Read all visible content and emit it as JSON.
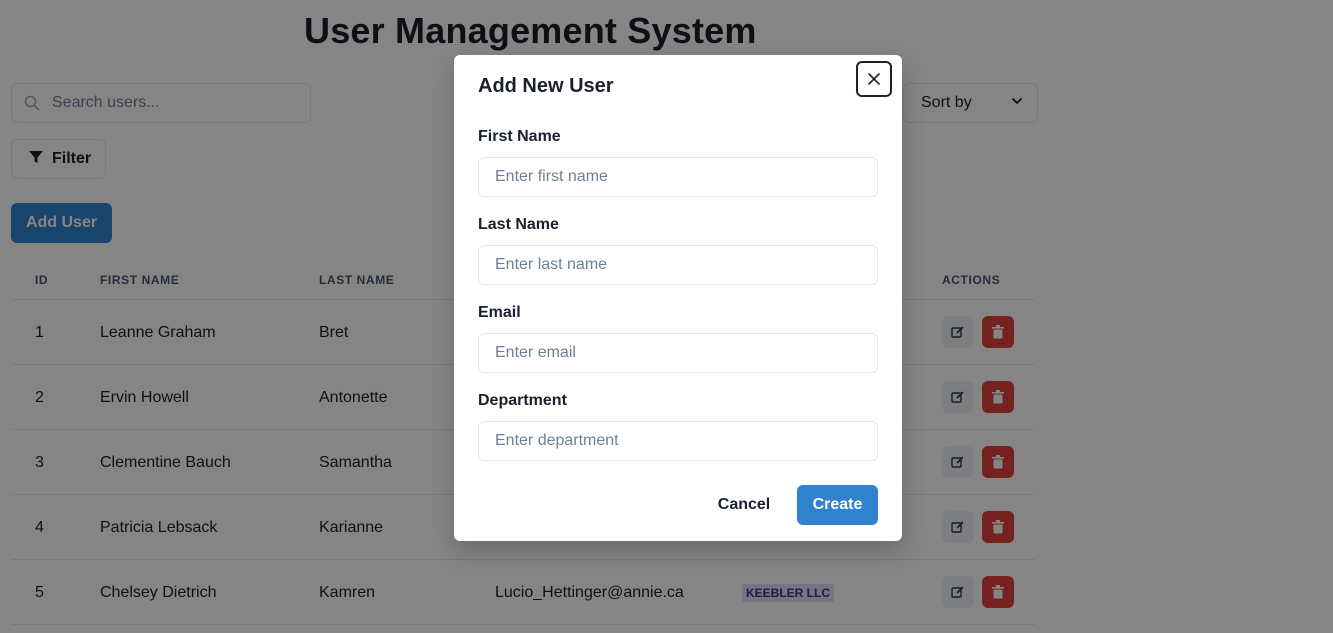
{
  "header": {
    "title": "User Management System"
  },
  "search": {
    "placeholder": "Search users..."
  },
  "sort": {
    "label": "Sort by"
  },
  "filter": {
    "label": "Filter"
  },
  "toolbar": {
    "add_user_label": "Add User"
  },
  "table": {
    "columns": [
      "ID",
      "FIRST NAME",
      "LAST NAME",
      "ACTIONS"
    ],
    "rows": [
      {
        "id": "1",
        "first_name": "Leanne Graham",
        "last_name": "Bret",
        "email": "",
        "company": ""
      },
      {
        "id": "2",
        "first_name": "Ervin Howell",
        "last_name": "Antonette",
        "email": "",
        "company": ""
      },
      {
        "id": "3",
        "first_name": "Clementine Bauch",
        "last_name": "Samantha",
        "email": "",
        "company": ""
      },
      {
        "id": "4",
        "first_name": "Patricia Lebsack",
        "last_name": "Karianne",
        "email": "",
        "company": ""
      },
      {
        "id": "5",
        "first_name": "Chelsey Dietrich",
        "last_name": "Kamren",
        "email": "Lucio_Hettinger@annie.ca",
        "company": "KEEBLER LLC"
      }
    ]
  },
  "modal": {
    "title": "Add New User",
    "fields": {
      "first_name": {
        "label": "First Name",
        "placeholder": "Enter first name"
      },
      "last_name": {
        "label": "Last Name",
        "placeholder": "Enter last name"
      },
      "email": {
        "label": "Email",
        "placeholder": "Enter email"
      },
      "department": {
        "label": "Department",
        "placeholder": "Enter department"
      }
    },
    "cancel_label": "Cancel",
    "create_label": "Create"
  },
  "colors": {
    "primary": "#3182ce",
    "danger": "#e53e3e",
    "badge_bg": "#e9d8fd",
    "badge_text": "#44337a"
  }
}
